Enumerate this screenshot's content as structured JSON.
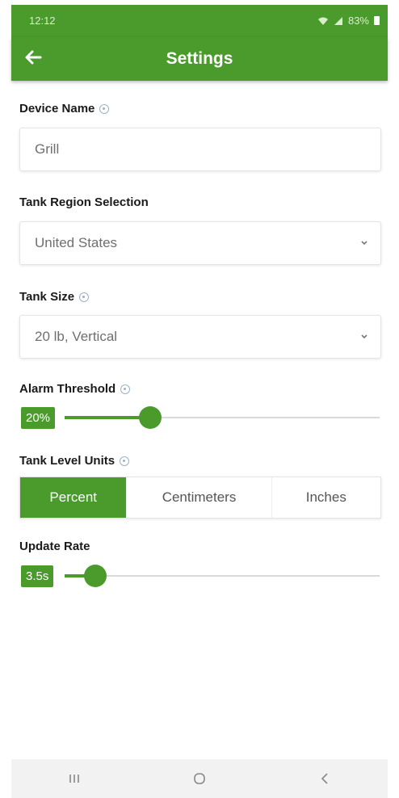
{
  "status_bar": {
    "time": "12:12",
    "battery": "83%"
  },
  "header": {
    "title": "Settings",
    "back_icon": "arrow-left-icon"
  },
  "device_name": {
    "label": "Device Name",
    "value": "Grill"
  },
  "tank_region": {
    "label": "Tank Region Selection",
    "selected": "United States"
  },
  "tank_size": {
    "label": "Tank Size",
    "selected": "20 lb, Vertical"
  },
  "alarm_threshold": {
    "label": "Alarm Threshold",
    "value_label": "20%",
    "value": 20
  },
  "tank_level_units": {
    "label": "Tank Level Units",
    "options": [
      "Percent",
      "Centimeters",
      "Inches"
    ],
    "selected": "Percent"
  },
  "update_rate": {
    "label": "Update Rate",
    "value_label": "3.5s"
  },
  "colors": {
    "accent": "#4a9a2c",
    "help_icon": "#9bb0c6"
  },
  "nav_bar": {
    "icons": [
      "recent-apps-icon",
      "home-icon",
      "back-icon"
    ]
  }
}
